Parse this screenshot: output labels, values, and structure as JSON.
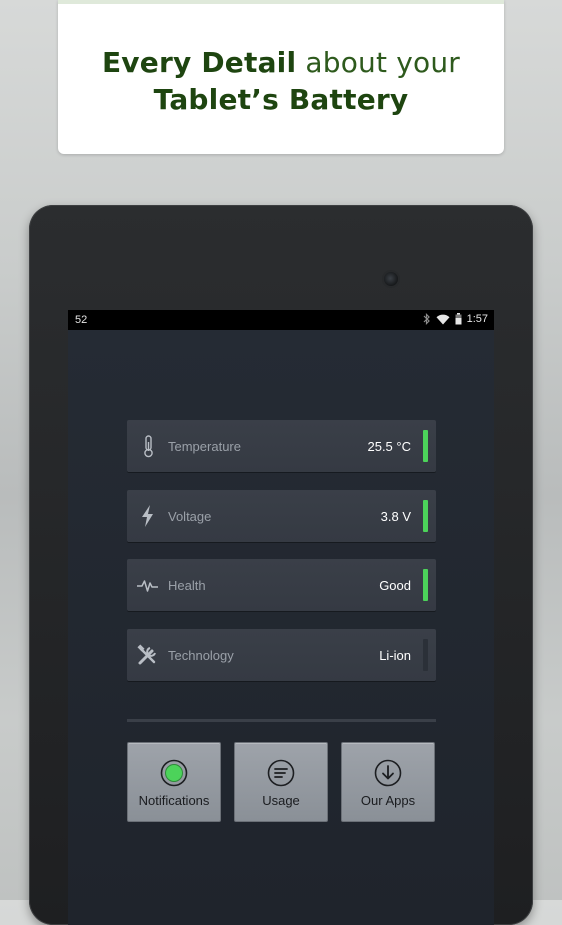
{
  "promo": {
    "line1_bold": "Every Detail",
    "line1_light": "about your",
    "line2_bold": "Tablet’s Battery"
  },
  "statusbar": {
    "left_text": "52",
    "time": "1:57",
    "icons": [
      "bluetooth-icon",
      "wifi-icon",
      "battery-icon"
    ]
  },
  "rows": [
    {
      "label": "Temperature",
      "value": "25.5 °C",
      "icon": "thermometer-icon",
      "status_color": "#4cd35a"
    },
    {
      "label": "Voltage",
      "value": "3.8 V",
      "icon": "lightning-icon",
      "status_color": "#4cd35a"
    },
    {
      "label": "Health",
      "value": "Good",
      "icon": "pulse-icon",
      "status_color": "#4cd35a"
    },
    {
      "label": "Technology",
      "value": "Li-ion",
      "icon": "tools-icon",
      "status_color": "#2b3038"
    }
  ],
  "buttons": [
    {
      "label": "Notifications",
      "icon": "notification-toggle-icon",
      "state": "on"
    },
    {
      "label": "Usage",
      "icon": "usage-list-icon"
    },
    {
      "label": "Our Apps",
      "icon": "download-icon"
    }
  ],
  "colors": {
    "promo_text": "#234d14",
    "indicator_on": "#4cd35a",
    "button_face": "#9ea3aa"
  }
}
